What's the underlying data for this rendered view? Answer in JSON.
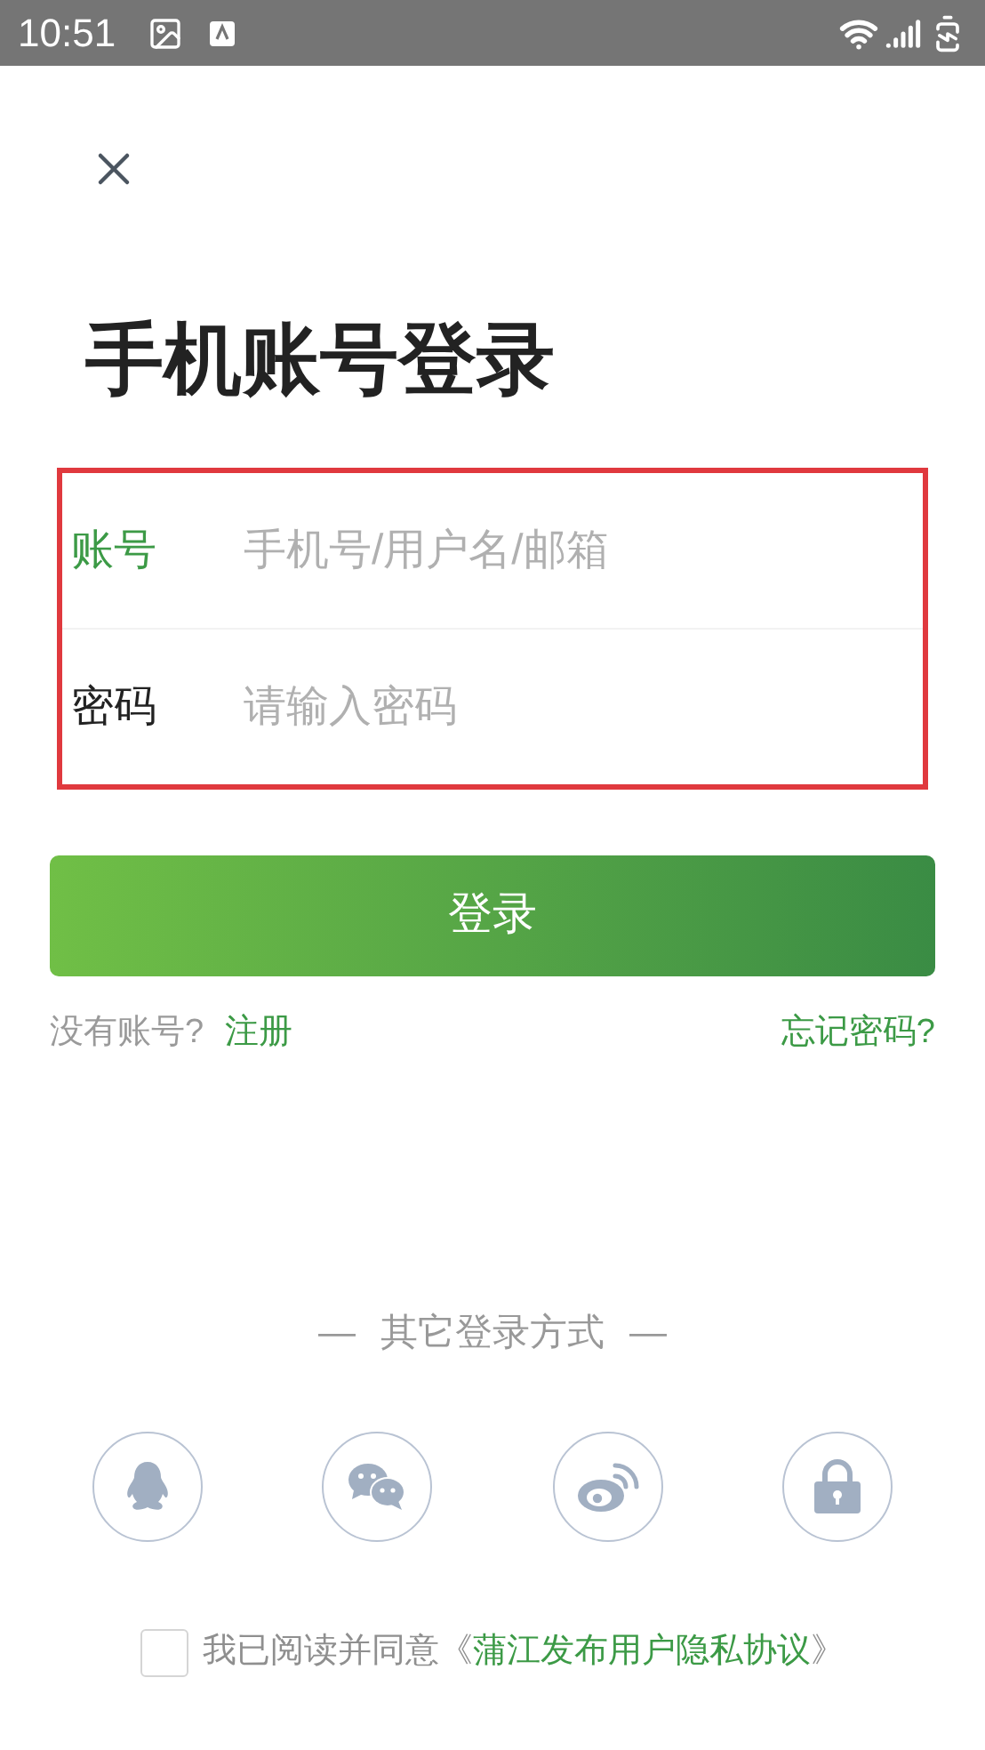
{
  "status_bar": {
    "time": "10:51"
  },
  "title": "手机账号登录",
  "form": {
    "highlighted": true,
    "fields": [
      {
        "label": "账号",
        "placeholder": "手机号/用户名/邮箱",
        "focused": true
      },
      {
        "label": "密码",
        "placeholder": "请输入密码",
        "focused": false
      }
    ]
  },
  "login_button": "登录",
  "register_prompt": "没有账号?",
  "register_link": "注册",
  "forgot_link": "忘记密码?",
  "other_login": {
    "dash_left": "—",
    "label": "其它登录方式",
    "dash_right": "—",
    "methods": [
      {
        "kind": "qq"
      },
      {
        "kind": "wechat"
      },
      {
        "kind": "weibo"
      },
      {
        "kind": "password"
      }
    ]
  },
  "agreement": {
    "checked": false,
    "text": "我已阅读并同意",
    "open_mark": "《",
    "link": "蒲江发布用户隐私协议",
    "close_mark": "》"
  }
}
